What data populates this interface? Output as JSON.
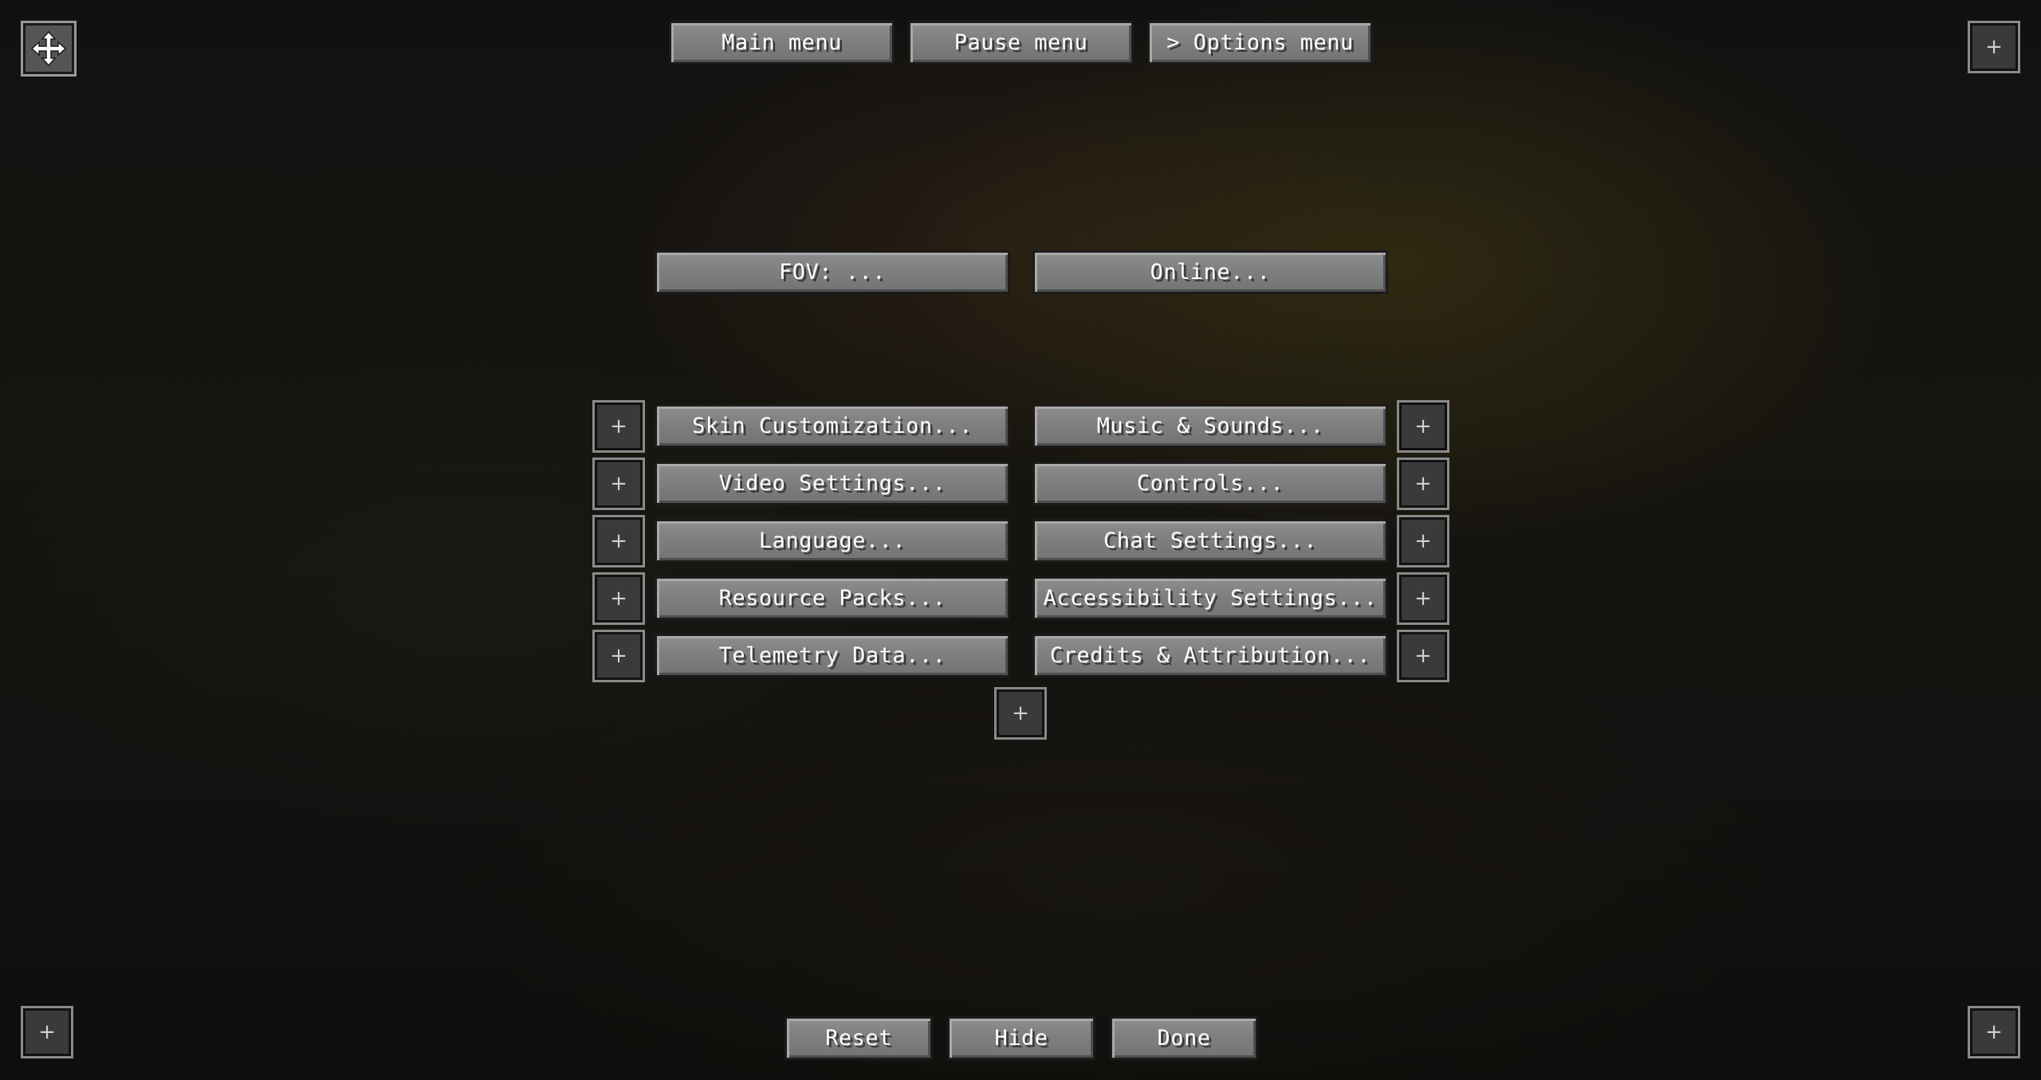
{
  "top_nav": {
    "main_menu": "Main menu",
    "pause_menu": "Pause menu",
    "options_menu": "> Options menu"
  },
  "options": {
    "fov": "FOV: ...",
    "online": "Online...",
    "left_column": [
      "Skin Customization...",
      "Video Settings...",
      "Language...",
      "Resource Packs...",
      "Telemetry Data..."
    ],
    "right_column": [
      "Music & Sounds...",
      "Controls...",
      "Chat Settings...",
      "Accessibility Settings...",
      "Credits & Attribution..."
    ]
  },
  "add_button_glyph": "+",
  "bottom_bar": {
    "reset": "Reset",
    "hide": "Hide",
    "done": "Done"
  },
  "icons": {
    "move": "move-arrows-icon",
    "add": "plus-icon"
  }
}
